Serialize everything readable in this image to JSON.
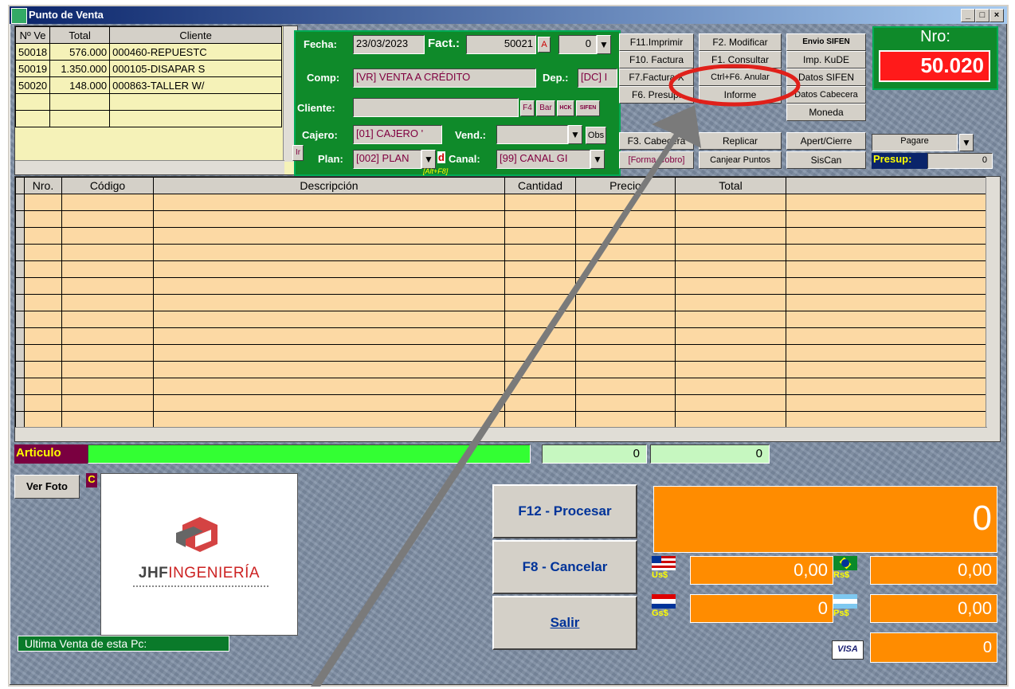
{
  "window": {
    "title": "Punto de Venta"
  },
  "sales_grid": {
    "headers": [
      "Nº Ve",
      "Total",
      "Cliente"
    ],
    "rows": [
      [
        "50018",
        "576.000",
        "000460-REPUESTC"
      ],
      [
        "50019",
        "1.350.000",
        "000105-DISAPAR S"
      ],
      [
        "50020",
        "148.000",
        "000863-TALLER W/"
      ]
    ]
  },
  "header_form": {
    "fecha_label": "Fecha:",
    "fecha_value": "23/03/2023",
    "fact_label": "Fact.:",
    "fact_value": "50021",
    "fact_suffix": "A",
    "fact_combo": "0",
    "comp_label": "Comp:",
    "comp_value": "[VR] VENTA A CRÉDITO",
    "dep_label": "Dep.:",
    "dep_value": "[DC] I",
    "cliente_label": "Cliente:",
    "cliente_value": "",
    "f4_label": "F4",
    "bar_label": "Bar",
    "hck_label": "HCK",
    "sifen_label": "SIFEN",
    "cajero_label": "Cajero:",
    "cajero_value": "[01] CAJERO '",
    "vend_label": "Vend.:",
    "vend_value": "",
    "obs_label": "Obs",
    "plan_label": "Plan:",
    "plan_value": "[002] PLAN",
    "canal_label": "Canal:",
    "canal_value": "[99] CANAL GI",
    "ir_label": "Ir",
    "d_label": "d",
    "altf8_label": "[Alt+F8]"
  },
  "function_buttons": {
    "f11": "F11.Imprimir",
    "f2": "F2. Modificar",
    "envio": "Envio SIFEN",
    "f10": "F10. Factura",
    "f1": "F1. Consultar",
    "kude": "Imp. KuDE",
    "f7": "F7.Factura X",
    "ctrlf6": "Ctrl+F6. Anular",
    "datos_sifen": "Datos SIFEN",
    "f6": "F6. Presup.",
    "informe": "Informe",
    "datos_cab": "Datos Cabecera",
    "moneda": "Moneda",
    "f3": "F3. Cabecera",
    "replicar": "Replicar",
    "apert": "Apert/Cierre",
    "forma": "[Forma Cobro]",
    "canjear": "Canjear Puntos",
    "siscan": "SisCan",
    "pagare": "Pagare",
    "presup_label": "Presup:",
    "presup_value": "0"
  },
  "nro": {
    "label": "Nro:",
    "value": "50.020"
  },
  "items_grid": {
    "headers": [
      "Nro.",
      "Código",
      "Descripción",
      "Cantidad",
      "Precio",
      "Total"
    ]
  },
  "articulo": {
    "label": "Articulo",
    "value": "",
    "qty": "0",
    "amount": "0"
  },
  "ver_foto_label": "Ver Foto",
  "c_label": "C",
  "logo_text": "JHFINGENIERÍA",
  "ultima_venta_label": "Ultima Venta de esta Pc:",
  "actions": {
    "procesar": "F12 - Procesar",
    "cancelar": "F8 - Cancelar",
    "salir": "Salir"
  },
  "totals": {
    "main": "0",
    "us_label": "Us$",
    "us_value": "0,00",
    "rs_label": "Rs$",
    "rs_value": "0,00",
    "gs_label": "Gs$",
    "gs_value": "0",
    "ps_label": "Ps$",
    "ps_value": "0,00",
    "visa_label": "VISA",
    "visa_value": "0"
  },
  "colors": {
    "highlight_circle": "#e0201a",
    "arrow": "#7a7a7a",
    "green": "#0f8a2a",
    "orange": "#ff8c00"
  }
}
